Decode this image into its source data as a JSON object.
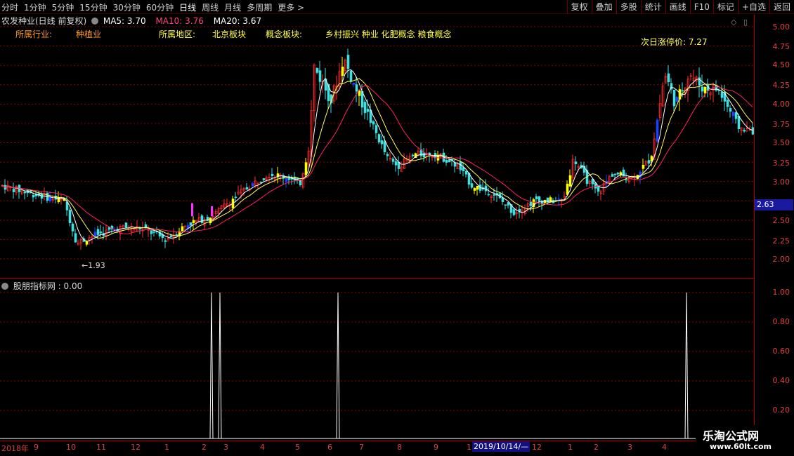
{
  "toolbar": {
    "periods": [
      "分时",
      "1分钟",
      "5分钟",
      "15分钟",
      "30分钟",
      "60分钟",
      "日线",
      "周线",
      "月线",
      "多周期",
      "更多"
    ],
    "active_period": "日线",
    "actions": [
      "复权",
      "叠加",
      "多股",
      "统计",
      "画线",
      "F10",
      "标记",
      "+自选",
      "返回"
    ]
  },
  "header": {
    "stock_title": "农发种业(日线 前复权)",
    "ma5": "MA5: 3.70",
    "ma10": "MA10: 3.76",
    "ma20": "MA20: 3.67"
  },
  "sector": {
    "industry_label": "所属行业:",
    "industry_value": "种植业",
    "region_label": "所属地区:",
    "region_value": "北京板块",
    "concept_label": "概念板块:",
    "concept_value": "乡村振兴 种业 化肥概念 粮食概念"
  },
  "annotations": {
    "limit_up": "次日涨停价: 7.27",
    "low_marker": "1.93",
    "current_price": "2.63"
  },
  "price_axis": [
    "5.00",
    "4.75",
    "4.50",
    "4.25",
    "4.00",
    "3.75",
    "3.50",
    "3.25",
    "3.00",
    "2.75",
    "2.50",
    "2.25",
    "2.00"
  ],
  "indicator": {
    "title": "股朋指标网 : 0.00",
    "axis": [
      "1.00",
      "0.80",
      "0.60",
      "0.40",
      "0.20"
    ]
  },
  "time_axis": {
    "labels": [
      "2018年",
      "9",
      "10",
      "11",
      "12",
      "1",
      "2",
      "3",
      "4",
      "5",
      "6",
      "7",
      "8",
      "9",
      "1",
      "12",
      "1",
      "2",
      "3",
      "4"
    ],
    "cursor_date": "2019/10/14/—"
  },
  "watermark": {
    "line1": "乐淘公式网",
    "line2": "www.60lt.com"
  },
  "colors": {
    "up": "#ff3030",
    "down": "#40e0e0",
    "signal_yellow": "#ffff00",
    "signal_blue": "#2040ff",
    "signal_magenta": "#ff30ff",
    "ma5": "#ffffff",
    "ma10": "#ffff60",
    "ma20": "#ff2060",
    "grid": "#8b0000"
  },
  "chart_data": {
    "type": "line",
    "title": "",
    "ylabel": "",
    "ylim": [
      1.8,
      5.1
    ],
    "series": [
      {
        "name": "MA20",
        "values": [
          2.95,
          2.9,
          2.85,
          2.82,
          2.8,
          2.75,
          2.55,
          2.35,
          2.3,
          2.35,
          2.45,
          2.45,
          2.4,
          2.4,
          2.45,
          2.55,
          2.7,
          2.85,
          3.0,
          3.1,
          3.05,
          3.0,
          3.3,
          3.8,
          4.1,
          4.3,
          4.2,
          3.95,
          3.65,
          3.5,
          3.4,
          3.4,
          3.35,
          3.1,
          2.95,
          2.85,
          2.75,
          2.7,
          2.75,
          2.8,
          2.8,
          2.95,
          3.05,
          3.05,
          3.1,
          3.15,
          3.2,
          3.5,
          3.9,
          4.1,
          4.2,
          4.25,
          4.15,
          3.95,
          3.8
        ]
      }
    ],
    "indicator_spikes": [
      1.0,
      1.0,
      1.0,
      1.0
    ]
  }
}
